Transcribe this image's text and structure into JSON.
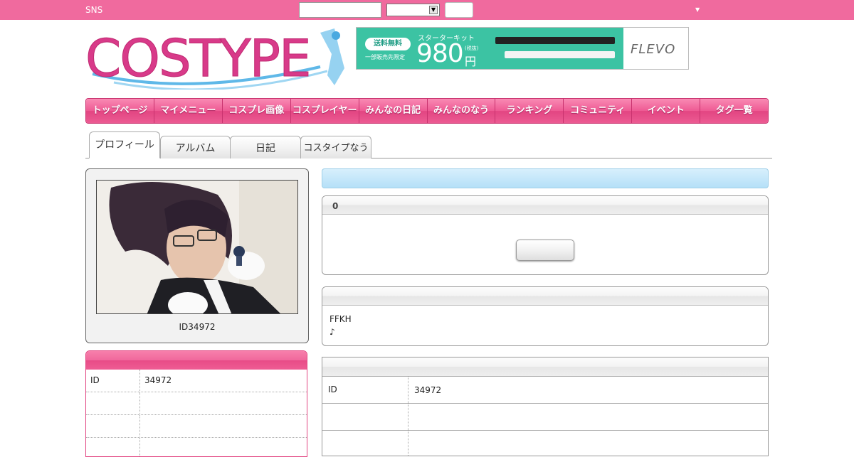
{
  "topbar": {
    "site_label": "SNS",
    "search_placeholder": "",
    "select_value": "",
    "submit_label": ""
  },
  "logo": {
    "text": "COSTYPE"
  },
  "ad": {
    "free_shipping": "送料無料",
    "limited": "一部販売先限定",
    "starter_kit": "スターターキット",
    "price": "980",
    "yen": "円",
    "tax": "(税抜)",
    "brand": "FLEVO"
  },
  "nav": {
    "items": [
      "トップページ",
      "マイメニュー",
      "コスプレ画像",
      "コスプレイヤー",
      "みんなの日記",
      "みんなのなう",
      "ランキング",
      "コミュニティ",
      "イベント",
      "タグ一覧"
    ]
  },
  "tabs": [
    "プロフィール",
    "アルバム",
    "日記",
    "コスタイプなう"
  ],
  "profile": {
    "caption": "ID34972"
  },
  "info": {
    "rows": [
      {
        "key": "ID",
        "value": "34972"
      },
      {
        "key": "",
        "value": ""
      },
      {
        "key": "",
        "value": ""
      },
      {
        "key": "",
        "value": ""
      }
    ]
  },
  "panels": {
    "count_title": "0",
    "comment_lines": [
      "FFKH",
      "♪"
    ]
  },
  "detail": {
    "rows": [
      {
        "key": "ID",
        "value": "34972"
      },
      {
        "key": "",
        "value": ""
      },
      {
        "key": "",
        "value": ""
      }
    ]
  },
  "colors": {
    "brand_pink": "#f06a9e",
    "nav_pink": "#e24582",
    "ad_green": "#3cc3a3",
    "highlight_blue": "#b5e0f8"
  }
}
